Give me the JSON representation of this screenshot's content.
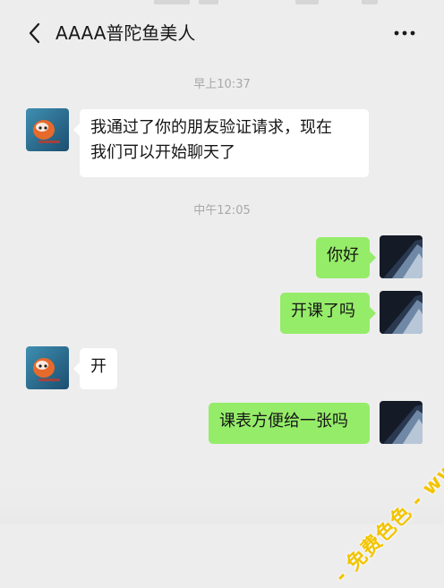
{
  "header": {
    "title": "AAAA普陀鱼美人",
    "back_icon": "chevron-left-icon",
    "more_icon": "more-dots-icon"
  },
  "messages": [
    {
      "type": "time",
      "text": "早上10:37"
    },
    {
      "type": "text",
      "side": "left",
      "lines": [
        "我通过了你的朋友验证请求，现在",
        "我们可以开始聊天了"
      ]
    },
    {
      "type": "time",
      "text": "中午12:05"
    },
    {
      "type": "text",
      "side": "right",
      "text": "你好"
    },
    {
      "type": "text",
      "side": "right",
      "text": "开课了吗"
    },
    {
      "type": "text",
      "side": "left",
      "text": "开"
    },
    {
      "type": "text",
      "side": "right",
      "text": "课表方便给一张吗"
    }
  ],
  "watermark": {
    "text": "- 免费色色 - www.MFsese.com"
  },
  "colors": {
    "background": "#ededed",
    "bubble_sent": "#95ec69",
    "bubble_received": "#ffffff",
    "watermark": "#f2c400"
  }
}
